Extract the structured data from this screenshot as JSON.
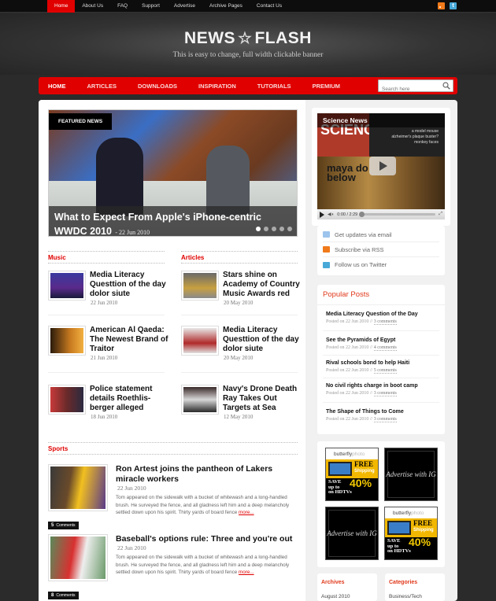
{
  "topbar": {
    "nav": [
      "Home",
      "About Us",
      "FAQ",
      "Support",
      "Advertise",
      "Archive Pages",
      "Contact Us"
    ],
    "active": "Home",
    "icons": [
      "rss-icon",
      "twitter-icon"
    ]
  },
  "header": {
    "logo_left": "NEWS",
    "logo_right": "FLASH",
    "tagline": "This is easy to change, full width clickable banner"
  },
  "mainnav": {
    "items": [
      "HOME",
      "ARTICLES",
      "DOWNLOADS",
      "INSPIRATION",
      "TUTORIALS",
      "PREMIUM"
    ],
    "search_placeholder": "Search here"
  },
  "featured": {
    "badge": "FEATURED NEWS",
    "title": "What to Expect From Apple's iPhone-centric WWDC 2010",
    "date": "- 22 Jun 2010",
    "slides": 5,
    "active_slide": 1
  },
  "sections": {
    "music": {
      "title": "Music",
      "posts": [
        {
          "title": "Media Literacy Questtion of the day dolor siute",
          "date": "22 Jun 2010"
        },
        {
          "title": "American Al Qaeda: The Newest Brand of Traitor",
          "date": "21 Jun 2010"
        },
        {
          "title": "Police statement details Roethlis-berger alleged",
          "date": "18 Jun 2010"
        }
      ]
    },
    "articles": {
      "title": "Articles",
      "posts": [
        {
          "title": "Stars shine on Academy of Country Music Awards red",
          "date": "20 May 2010"
        },
        {
          "title": "Media Literacy Questtion of the day dolor siute",
          "date": "20 May 2010"
        },
        {
          "title": "Navy's Drone Death Ray Takes Out Targets at Sea",
          "date": "12 May 2010"
        }
      ]
    },
    "sports": {
      "title": "Sports",
      "posts": [
        {
          "title": "Ron Artest joins the pantheon of Lakers miracle workers",
          "date": "22 Jun 2010",
          "comments_count": "5",
          "comments_label": "Comments",
          "excerpt": "Tom appeared on the sidewalk with a bucket of whitewash and a long-handled brush. He surveyed the fence, and all gladness left him and a deep melancholy settled down upon his spirit. Thirty yards of board fence ",
          "more": "more..."
        },
        {
          "title": "Baseball's options rule: Three and you're out",
          "date": "22 Jun 2010",
          "comments_count": "8",
          "comments_label": "Comments",
          "excerpt": "Tom appeared on the sidewalk with a bucket of whitewash and a long-handled brush. He surveyed the fence, and all gladness left him and a deep melancholy settled down upon his spirit. Thirty yards of board fence ",
          "more": "more..."
        }
      ]
    }
  },
  "video": {
    "title": "Science News",
    "cover_word": "SCIENCE NEWS",
    "cover_lines": [
      "a model mouse",
      "alzheimer's plaque buster?",
      "monkey faces"
    ],
    "cover_headline": "maya do below",
    "time": "0:00 / 2:29"
  },
  "subscribe": [
    {
      "icon": "email-icon",
      "label": "Get updates via email",
      "color": "#6aa8e0"
    },
    {
      "icon": "rss-icon",
      "label": "Subscribe via RSS",
      "color": "#f07a1a"
    },
    {
      "icon": "twitter-icon",
      "label": "Follow us on Twitter",
      "color": "#48a8d8"
    }
  ],
  "popular": {
    "title": "Popular Posts",
    "posts": [
      {
        "title": "Media Literacy Question of the Day",
        "posted": "Posted on 22 Jun 2010",
        "comments": "3 comments"
      },
      {
        "title": "See the Pyramids of Egypt",
        "posted": "Posted on 22 Jun 2010",
        "comments": "4 comments"
      },
      {
        "title": "Rival schools bond to help Haiti",
        "posted": "Posted on 22 Jun 2010",
        "comments": "5 comments"
      },
      {
        "title": "No civil rights charge in boot camp",
        "posted": "Posted on 22 Jun 2010",
        "comments": "3 comments"
      },
      {
        "title": "The Shape of Things to Come",
        "posted": "Posted on 22 Jun 2010",
        "comments": "3 comments"
      }
    ]
  },
  "ads": {
    "butterfly": {
      "brand": "butterfly",
      "brand_suffix": "photo",
      "free": "FREE",
      "shipping": "Shipping",
      "save": "SAVE",
      "upto": "up to",
      "on": "on HDTVs",
      "pct": "40%"
    },
    "advertise": "Advertise with IG"
  },
  "archives": {
    "title": "Archives",
    "first": "August 2010"
  },
  "categories": {
    "title": "Categories",
    "first": "Business/Tech"
  },
  "colors": {
    "accent": "#e00000",
    "widget_heading": "#e0381a"
  }
}
